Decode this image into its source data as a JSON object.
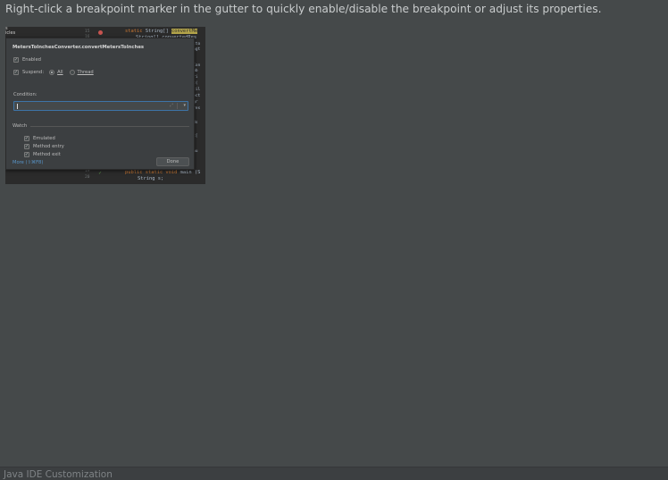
{
  "tip": {
    "text": "Right-click a breakpoint marker in the gutter to quickly enable/disable the breakpoint or adjust its properties."
  },
  "screenshot": {
    "left_strip": [
      "s",
      "icles"
    ],
    "gutter_numbers": [
      "15",
      "16",
      "17",
      "18",
      "19",
      "20"
    ],
    "code_lines": {
      "line1_keyword": "static",
      "line1_text": " String[] ",
      "line1_method": "convertMe",
      "line2": "String[] convertedRes",
      "line_bottom_keyword": "public static void",
      "line_bottom_rest": " main (S",
      "line_last": "String s;"
    },
    "side_fragments": [
      "cto",
      "ngt",
      "Con",
      "ub",
      "ri",
      "t(",
      "til",
      "ect",
      "gr",
      "res",
      "",
      "ds",
      "",
      "t[",
      "",
      "nu"
    ],
    "dialog": {
      "title": "MetersToInchesConverter.convertMetersToInches",
      "enabled": {
        "label": "Enabled",
        "checked": true
      },
      "suspend": {
        "label": "Suspend:",
        "checked": true
      },
      "suspend_options": [
        {
          "label": "All",
          "selected": true
        },
        {
          "label": "Thread",
          "selected": false
        }
      ],
      "condition_label": "Condition:",
      "condition_value": "",
      "watch_label": "Watch",
      "watch_items": [
        {
          "label": "Emulated",
          "checked": true
        },
        {
          "label": "Method entry",
          "checked": true
        },
        {
          "label": "Method exit",
          "checked": true
        }
      ],
      "more_link": "More (⇧⌘F8)",
      "done_button": "Done"
    }
  },
  "footer": {
    "text": "Java IDE Customization"
  },
  "colors": {
    "background": "#45494a",
    "tip_text": "#c9cccd",
    "dialog_bg": "#3c3f41",
    "link": "#5894c8",
    "focus_border": "#3d74a7",
    "footer_text": "#7f8386"
  },
  "icons": {
    "breakpoint": "breakpoint-marker-icon",
    "check": "check-icon",
    "expand": "expand-icon",
    "dropdown": "chevron-down-icon"
  }
}
